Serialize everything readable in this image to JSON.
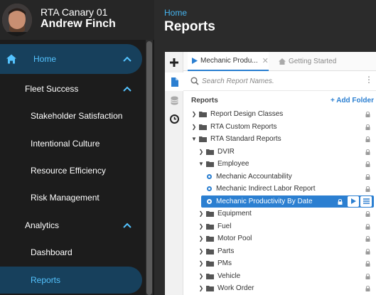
{
  "profile": {
    "org": "RTA Canary 01",
    "user": "Andrew Finch"
  },
  "nav": {
    "home": "Home",
    "fleet_success": "Fleet Success",
    "stakeholder": "Stakeholder Satisfaction",
    "culture": "Intentional Culture",
    "resource": "Resource Efficiency",
    "risk": "Risk Management",
    "analytics": "Analytics",
    "dashboard": "Dashboard",
    "reports": "Reports"
  },
  "header": {
    "breadcrumb": "Home",
    "title": "Reports"
  },
  "tabs": {
    "active": "Mechanic Produ...",
    "inactive": "Getting Started"
  },
  "search": {
    "placeholder": "Search Report Names."
  },
  "tree": {
    "header": "Reports",
    "add_folder": "+ Add Folder",
    "items": [
      {
        "label": "Report Design Classes",
        "type": "folder",
        "expanded": false,
        "level": 0
      },
      {
        "label": "RTA Custom Reports",
        "type": "folder",
        "expanded": false,
        "level": 0
      },
      {
        "label": "RTA Standard Reports",
        "type": "folder",
        "expanded": true,
        "level": 0
      },
      {
        "label": "DVIR",
        "type": "folder",
        "expanded": false,
        "level": 1
      },
      {
        "label": "Employee",
        "type": "folder",
        "expanded": true,
        "level": 1
      },
      {
        "label": "Mechanic Accountability",
        "type": "report",
        "level": 2
      },
      {
        "label": "Mechanic Indirect Labor Report",
        "type": "report",
        "level": 2
      },
      {
        "label": "Mechanic Productivity By Date",
        "type": "report",
        "level": 2,
        "selected": true
      },
      {
        "label": "Equipment",
        "type": "folder",
        "expanded": false,
        "level": 1
      },
      {
        "label": "Fuel",
        "type": "folder",
        "expanded": false,
        "level": 1
      },
      {
        "label": "Motor Pool",
        "type": "folder",
        "expanded": false,
        "level": 1
      },
      {
        "label": "Parts",
        "type": "folder",
        "expanded": false,
        "level": 1
      },
      {
        "label": "PMs",
        "type": "folder",
        "expanded": false,
        "level": 1
      },
      {
        "label": "Vehicle",
        "type": "folder",
        "expanded": false,
        "level": 1
      },
      {
        "label": "Work Order",
        "type": "folder",
        "expanded": false,
        "level": 1
      }
    ]
  },
  "colors": {
    "accent": "#2b7fd1",
    "nav_active_bg": "#17405c",
    "nav_active_text": "#54c3ff",
    "sidebar_bg": "#1c1c1c"
  }
}
